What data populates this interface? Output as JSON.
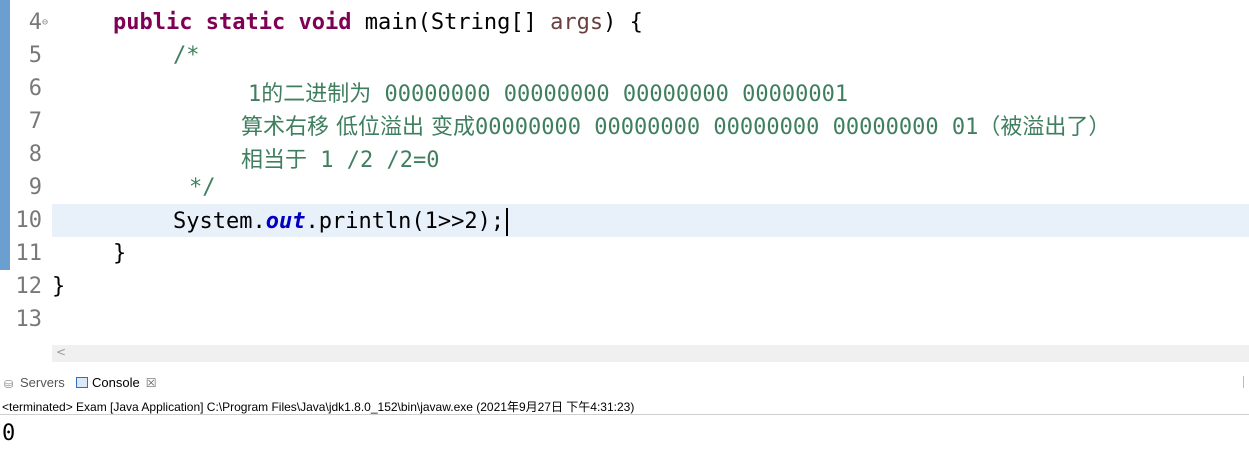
{
  "editor": {
    "lines": [
      {
        "no": "4",
        "folded_marker": "⊖"
      },
      {
        "no": "5"
      },
      {
        "no": "6"
      },
      {
        "no": "7"
      },
      {
        "no": "8"
      },
      {
        "no": "9"
      },
      {
        "no": "10"
      },
      {
        "no": "11"
      },
      {
        "no": "12"
      },
      {
        "no": "13"
      }
    ],
    "code": {
      "l4": {
        "kw1": "public",
        "kw2": "static",
        "kw3": "void",
        "rest1": " main(String[] ",
        "var": "args",
        "rest2": ") {"
      },
      "l5": "/*",
      "l6": {
        "one": "1",
        "cjk": "的二进制为",
        "bits": " 00000000 00000000 00000000 00000001"
      },
      "l7": {
        "cjk1": "算术右移 低位溢出 变成",
        "bits": "00000000 00000000 00000000 00000000 01",
        "cjk2": "（被溢出了）"
      },
      "l8": {
        "cjk": "相当于",
        "expr": " 1 /2 /2=0"
      },
      "l9": "*/",
      "l10": {
        "pre": "System.",
        "field": "out",
        "post": ".println(1>>2);"
      },
      "l11": "}",
      "l12": "}"
    }
  },
  "panel": {
    "tabs": [
      {
        "label": "Servers",
        "icon": "servers-icon"
      },
      {
        "label": "Console",
        "icon": "console-icon",
        "close": "☒"
      }
    ],
    "status": "<terminated> Exam [Java Application] C:\\Program Files\\Java\\jdk1.8.0_152\\bin\\javaw.exe (2021年9月27日 下午4:31:23)",
    "output": "0"
  },
  "scroll": {
    "left_arrow": "<"
  }
}
